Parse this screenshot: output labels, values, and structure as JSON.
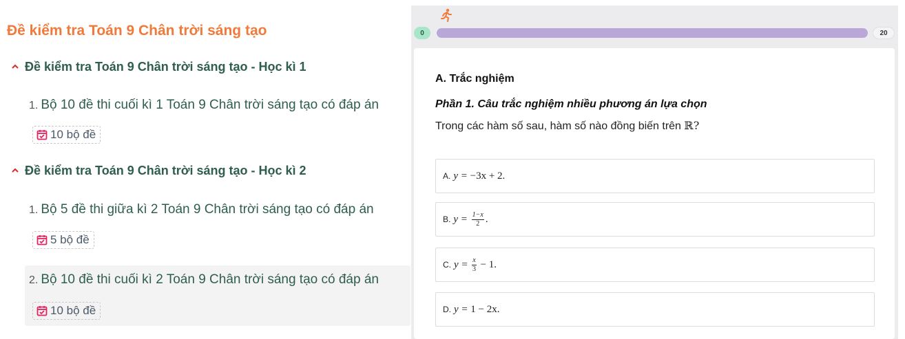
{
  "left": {
    "title": "Đề kiểm tra Toán 9 Chân trời sáng tạo",
    "sections": [
      {
        "heading": "Đề kiểm tra Toán 9 Chân trời sáng tạo - Học kì 1",
        "items": [
          {
            "num": "1.",
            "label": "Bộ 10 đề thi cuối kì 1 Toán 9 Chân trời sáng tạo có đáp án",
            "badge": "10 bộ đề"
          }
        ]
      },
      {
        "heading": "Đề kiểm tra Toán 9 Chân trời sáng tạo - Học kì 2",
        "items": [
          {
            "num": "1.",
            "label": "Bộ 5 đề thi giữa kì 2 Toán 9 Chân trời sáng tạo có đáp án",
            "badge": "5 bộ đề"
          },
          {
            "num": "2.",
            "label": "Bộ 10 đề thi cuối kì 2 Toán 9 Chân trời sáng tạo có đáp án",
            "badge": "10 bộ đề"
          }
        ]
      }
    ]
  },
  "progress": {
    "start": "0",
    "end": "20"
  },
  "quiz": {
    "section": "A. Trắc nghiệm",
    "part": "Phần 1. Câu trắc nghiệm nhiều phương án lựa chọn",
    "question": "Trong các hàm số sau, hàm số nào đồng biến trên ",
    "question_set": "ℝ?",
    "options": [
      {
        "letter": "A.",
        "lhs": "y = ",
        "rhs": "−3x + 2."
      },
      {
        "letter": "B.",
        "lhs": "y = ",
        "num": "1−x",
        "den": "2",
        "tail": "."
      },
      {
        "letter": "C.",
        "lhs": "y = ",
        "num": "x",
        "den": "3",
        "tail": " − 1."
      },
      {
        "letter": "D.",
        "lhs": "y = ",
        "rhs": "1 − 2x."
      }
    ]
  },
  "colors": {
    "title": "#f07a3a",
    "heading": "#2f5e4e",
    "badge_icon": "#e0245e",
    "progress_bar": "#b9a8d7",
    "runner": "#f07a3a"
  },
  "icons": {
    "section_toggle": "chevron-up-icon",
    "badge": "calendar-check-icon",
    "progress": "running-person-icon"
  }
}
